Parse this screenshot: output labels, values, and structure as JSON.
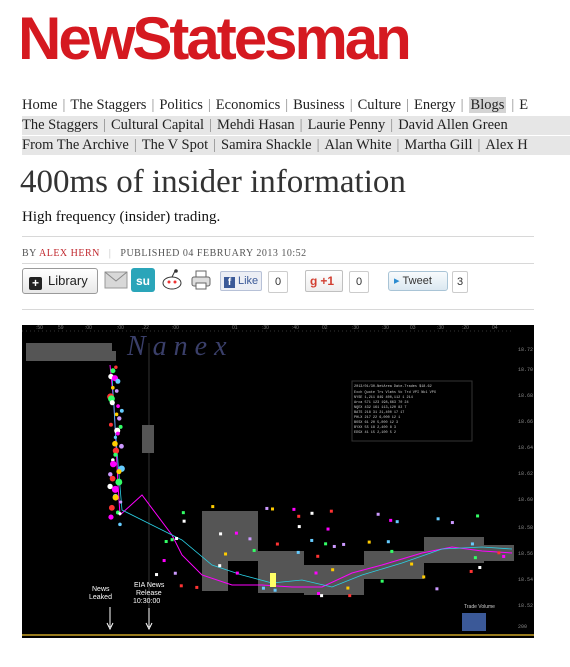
{
  "masthead": {
    "logo_text": "NewStatesman",
    "brand_color": "#d51920"
  },
  "nav": {
    "primary": [
      "Home",
      "The Staggers",
      "Politics",
      "Economics",
      "Business",
      "Culture",
      "Energy",
      "Blogs",
      "E"
    ],
    "blogs": [
      "The Staggers",
      "Cultural Capital",
      "Mehdi Hasan",
      "Laurie Penny",
      "David Allen Green"
    ],
    "more": [
      "From The Archive",
      "The V Spot",
      "Samira Shackle",
      "Alan White",
      "Martha Gill",
      "Alex H"
    ]
  },
  "article": {
    "title": "400ms of insider information",
    "standfirst": "High frequency (insider) trading.",
    "byline_prefix": "BY",
    "author": "ALEX HERN",
    "published": "PUBLISHED 04 FEBRUARY 2013 10:52"
  },
  "share": {
    "library_label": "Library",
    "like_label": "Like",
    "like_count": "0",
    "gplus_label": "+1",
    "gplus_count": "0",
    "tweet_label": "Tweet",
    "tweet_count": "3",
    "icons": [
      "email-icon",
      "stumbleupon-icon",
      "reddit-icon",
      "print-icon"
    ]
  },
  "chart_image": {
    "watermark": "N a n e x",
    "annotations": {
      "news_leaked": "News Leaked",
      "eia_release": "EIA News Release 10:30:00",
      "trade_volume": "Trade Volume"
    },
    "background_color": "#000000"
  }
}
